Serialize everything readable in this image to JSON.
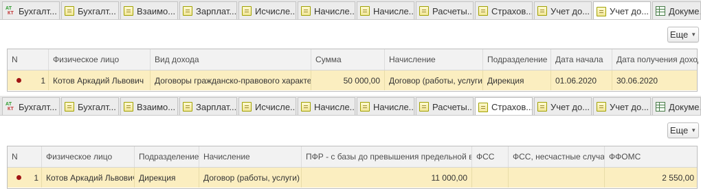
{
  "colors": {
    "row_highlight": "#fbeec0",
    "header_bg": "#f2f2f2",
    "tab_bg": "#ececec",
    "active_tab_bg": "#ffffff",
    "marker": "#a01515"
  },
  "top": {
    "tabs": [
      {
        "label": "Бухгалт...",
        "icon": "atkt-icon"
      },
      {
        "label": "Бухгалт...",
        "icon": "document-icon"
      },
      {
        "label": "Взаимо...",
        "icon": "document-icon"
      },
      {
        "label": "Зарплат...",
        "icon": "document-icon"
      },
      {
        "label": "Исчисле...",
        "icon": "document-icon"
      },
      {
        "label": "Начисле...",
        "icon": "document-icon"
      },
      {
        "label": "Начисле...",
        "icon": "document-icon"
      },
      {
        "label": "Расчеты...",
        "icon": "document-icon"
      },
      {
        "label": "Страхов...",
        "icon": "document-icon"
      },
      {
        "label": "Учет до...",
        "icon": "document-icon"
      },
      {
        "label": "Учет до...",
        "icon": "document-icon",
        "active": true
      },
      {
        "label": "Докуме...",
        "icon": "table-icon"
      }
    ],
    "more_label": "Еще",
    "columns": [
      "N",
      "Физическое лицо",
      "Вид дохода",
      "Сумма",
      "Начисление",
      "Подразделение",
      "Дата начала",
      "Дата получения дохода"
    ],
    "row": {
      "n": "1",
      "person": "Котов Аркадий Львович",
      "income_type": "Договоры гражданско-правового характера",
      "amount": "50 000,00",
      "accrual": "Договор (работы, услуги)",
      "department": "Дирекция",
      "start_date": "01.06.2020",
      "income_date": "30.06.2020"
    }
  },
  "bottom": {
    "tabs": [
      {
        "label": "Бухгалт...",
        "icon": "atkt-icon"
      },
      {
        "label": "Бухгалт...",
        "icon": "document-icon"
      },
      {
        "label": "Взаимо...",
        "icon": "document-icon"
      },
      {
        "label": "Зарплат...",
        "icon": "document-icon"
      },
      {
        "label": "Исчисле...",
        "icon": "document-icon"
      },
      {
        "label": "Начисле...",
        "icon": "document-icon"
      },
      {
        "label": "Начисле...",
        "icon": "document-icon"
      },
      {
        "label": "Расчеты...",
        "icon": "document-icon"
      },
      {
        "label": "Страхов...",
        "icon": "document-icon",
        "active": true
      },
      {
        "label": "Учет до...",
        "icon": "document-icon"
      },
      {
        "label": "Учет до...",
        "icon": "document-icon"
      },
      {
        "label": "Докуме...",
        "icon": "table-icon"
      }
    ],
    "more_label": "Еще",
    "columns": [
      "N",
      "Физическое лицо",
      "Подразделение",
      "Начисление",
      "ПФР - с базы до превышения предельной в...",
      "ФСС",
      "ФСС, несчастные случаи",
      "ФФОМС"
    ],
    "row": {
      "n": "1",
      "person": "Котов Аркадий Львович",
      "department": "Дирекция",
      "accrual": "Договор (работы, услуги)",
      "pfr": "11 000,00",
      "fss": "",
      "fss_accident": "",
      "ffoms": "2 550,00"
    }
  }
}
